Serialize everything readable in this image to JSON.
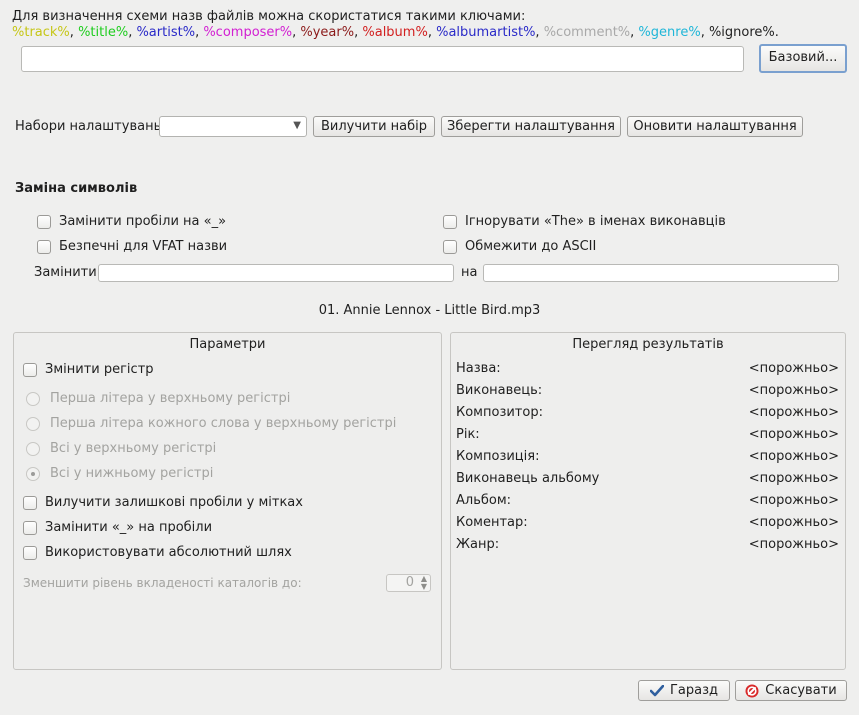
{
  "hint": {
    "text": "Для визначення схеми назв файлів можна скористатися такими ключами:",
    "tokens": [
      {
        "t": "%track%",
        "color": "#c6c617"
      },
      {
        "t": ", ",
        "color": "#1f1f1f"
      },
      {
        "t": "%title%",
        "color": "#1fcd1f"
      },
      {
        "t": ", ",
        "color": "#1f1f1f"
      },
      {
        "t": "%artist%",
        "color": "#2a2ac8"
      },
      {
        "t": ", ",
        "color": "#1f1f1f"
      },
      {
        "t": "%composer%",
        "color": "#d21fd2"
      },
      {
        "t": ", ",
        "color": "#1f1f1f"
      },
      {
        "t": "%year%",
        "color": "#8b1a1a"
      },
      {
        "t": ", ",
        "color": "#1f1f1f"
      },
      {
        "t": "%album%",
        "color": "#d21f1f"
      },
      {
        "t": ", ",
        "color": "#1f1f1f"
      },
      {
        "t": "%albumartist%",
        "color": "#2a2ac8"
      },
      {
        "t": ", ",
        "color": "#1f1f1f"
      },
      {
        "t": "%comment%",
        "color": "#a9a9a9"
      },
      {
        "t": ", ",
        "color": "#1f1f1f"
      },
      {
        "t": "%genre%",
        "color": "#1fb6d8"
      },
      {
        "t": ", ",
        "color": "#1f1f1f"
      },
      {
        "t": "%ignore%.",
        "color": "#1f1f1f"
      }
    ]
  },
  "scheme": {
    "value": "",
    "basic_button": "Базовий..."
  },
  "presets": {
    "label": "Набори налаштувань:",
    "selected": "",
    "remove_button": "Вилучити набір",
    "save_button": "Зберегти налаштування",
    "update_button": "Оновити налаштування"
  },
  "replace": {
    "title": "Заміна символів",
    "spaces_underscore": "Замінити пробіли на «_»",
    "ignore_the": "Ігнорувати «The» в іменах виконавців",
    "vfat_safe": "Безпечні для VFAT назви",
    "restrict_ascii": "Обмежити до ASCII",
    "replace_label": "Замінити",
    "with_label": "на",
    "replace_value": "",
    "with_value": ""
  },
  "example_file": "01. Annie Lennox - Little Bird.mp3",
  "params": {
    "title": "Параметри",
    "change_case": "Змінити регістр",
    "case_first_upper": "Перша літера у верхньому регістрі",
    "case_each_word": "Перша літера кожного слова у верхньому регістрі",
    "case_all_upper": "Всі у верхньому регістрі",
    "case_all_lower": "Всі у нижньому регістрі",
    "strip_spaces": "Вилучити залишкові пробіли у мітках",
    "underscore_spaces": "Замінити «_» на пробіли",
    "absolute_path": "Використовувати абсолютний шлях",
    "reduce_depth_label": "Зменшити рівень вкладеності каталогів до:",
    "reduce_depth_value": "0"
  },
  "preview": {
    "title": "Перегляд результатів",
    "rows": [
      {
        "label": "Назва:",
        "value": "<порожньо>"
      },
      {
        "label": "Виконавець:",
        "value": "<порожньо>"
      },
      {
        "label": "Композитор:",
        "value": "<порожньо>"
      },
      {
        "label": "Рік:",
        "value": "<порожньо>"
      },
      {
        "label": "Композиція:",
        "value": "<порожньо>"
      },
      {
        "label": "Виконавець альбому",
        "value": "<порожньо>"
      },
      {
        "label": "Альбом:",
        "value": "<порожньо>"
      },
      {
        "label": "Коментар:",
        "value": "<порожньо>"
      },
      {
        "label": "Жанр:",
        "value": "<порожньо>"
      }
    ]
  },
  "buttons": {
    "ok": "Гаразд",
    "cancel": "Скасувати"
  },
  "icons": {
    "ok": "checkmark-icon",
    "cancel": "cancel-icon",
    "combo": "chevron-down-icon",
    "spin": "spin-arrows-icon"
  }
}
